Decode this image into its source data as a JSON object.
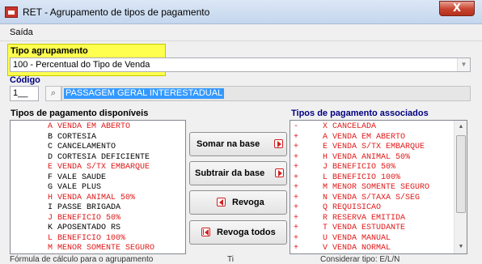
{
  "window": {
    "title": "RET - Agrupamento de tipos de pagamento",
    "close_glyph": "X"
  },
  "menu": {
    "saida": "Saída"
  },
  "tipo_agrupamento": {
    "label": "Tipo agrupamento",
    "value": "100 - Percentual do Tipo de Venda"
  },
  "codigo": {
    "label": "Código",
    "value": "1__",
    "description": "PASSAGEM GERAL INTERESTADUAL"
  },
  "disponiveis": {
    "label": "Tipos de pagamento disponíveis",
    "items": [
      {
        "code": "A",
        "name": "VENDA EM ABERTO",
        "color": "#e01818"
      },
      {
        "code": "B",
        "name": "CORTESIA",
        "color": "#000000"
      },
      {
        "code": "C",
        "name": "CANCELAMENTO",
        "color": "#000000"
      },
      {
        "code": "D",
        "name": "CORTESIA DEFICIENTE",
        "color": "#000000"
      },
      {
        "code": "E",
        "name": "VENDA S/TX EMBARQUE",
        "color": "#e01818"
      },
      {
        "code": "F",
        "name": "VALE SAUDE",
        "color": "#000000"
      },
      {
        "code": "G",
        "name": "VALE PLUS",
        "color": "#000000"
      },
      {
        "code": "H",
        "name": "VENDA ANIMAL 50%",
        "color": "#e01818"
      },
      {
        "code": "I",
        "name": "PASSE BRIGADA",
        "color": "#000000"
      },
      {
        "code": "J",
        "name": "BENEFICIO 50%",
        "color": "#e01818"
      },
      {
        "code": "K",
        "name": "APOSENTADO RS",
        "color": "#000000"
      },
      {
        "code": "L",
        "name": "BENEFICIO 100%",
        "color": "#e01818"
      },
      {
        "code": "M",
        "name": "MENOR SOMENTE SEGURO",
        "color": "#e01818"
      }
    ]
  },
  "associados": {
    "label": "Tipos de pagamento associados",
    "items": [
      {
        "sign": "-",
        "code": "X",
        "name": "CANCELADA"
      },
      {
        "sign": "+",
        "code": "A",
        "name": "VENDA EM ABERTO"
      },
      {
        "sign": "+",
        "code": "E",
        "name": "VENDA S/TX EMBARQUE"
      },
      {
        "sign": "+",
        "code": "H",
        "name": "VENDA ANIMAL 50%"
      },
      {
        "sign": "+",
        "code": "J",
        "name": "BENEFICIO 50%"
      },
      {
        "sign": "+",
        "code": "L",
        "name": "BENEFICIO 100%"
      },
      {
        "sign": "+",
        "code": "M",
        "name": "MENOR SOMENTE SEGURO"
      },
      {
        "sign": "+",
        "code": "N",
        "name": "VENDA S/TAXA S/SEG"
      },
      {
        "sign": "+",
        "code": "Q",
        "name": "REQUISICAO"
      },
      {
        "sign": "+",
        "code": "R",
        "name": "RESERVA EMITIDA"
      },
      {
        "sign": "+",
        "code": "T",
        "name": "VENDA ESTUDANTE"
      },
      {
        "sign": "+",
        "code": "U",
        "name": "VENDA MANUAL"
      },
      {
        "sign": "+",
        "code": "V",
        "name": "VENDA NORMAL"
      }
    ]
  },
  "buttons": {
    "somar": "Somar  na base",
    "subtrair": "Subtrair da base",
    "revoga": "Revoga",
    "revoga_todos": "Revoga todos"
  },
  "footer": {
    "formula": "Fórmula de cálculo para o agrupamento",
    "clipped_mid": "Ti",
    "clipped_right": "Considerar tipo: E/L/N"
  },
  "colors": {
    "accent_red": "#e01818",
    "highlight_yellow": "#ffff50",
    "label_navy": "#000080",
    "selection_blue": "#3399ff"
  }
}
